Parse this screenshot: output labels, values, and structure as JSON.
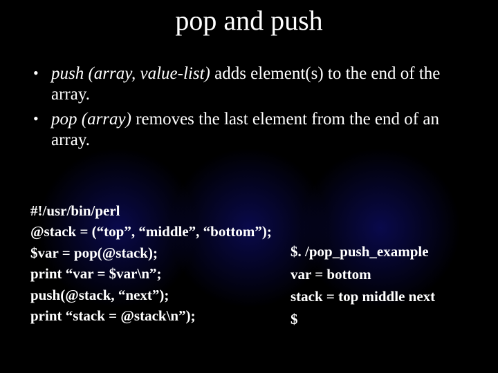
{
  "title": "pop and push",
  "bullets": [
    {
      "func": "push (array, value-list)",
      "rest": " adds element(s) to the end of the array."
    },
    {
      "func": "pop (array)",
      "rest": " removes the last element from the end of an array."
    }
  ],
  "code_left": [
    "#!/usr/bin/perl",
    "@stack = (“top”, “middle”, “bottom”);",
    "$var = pop(@stack);",
    "print “var = $var\\n”;",
    "push(@stack, “next”);",
    "print “stack = @stack\\n”);"
  ],
  "code_right": [
    "$. /pop_push_example",
    "var = bottom",
    "stack = top middle next",
    "$"
  ]
}
